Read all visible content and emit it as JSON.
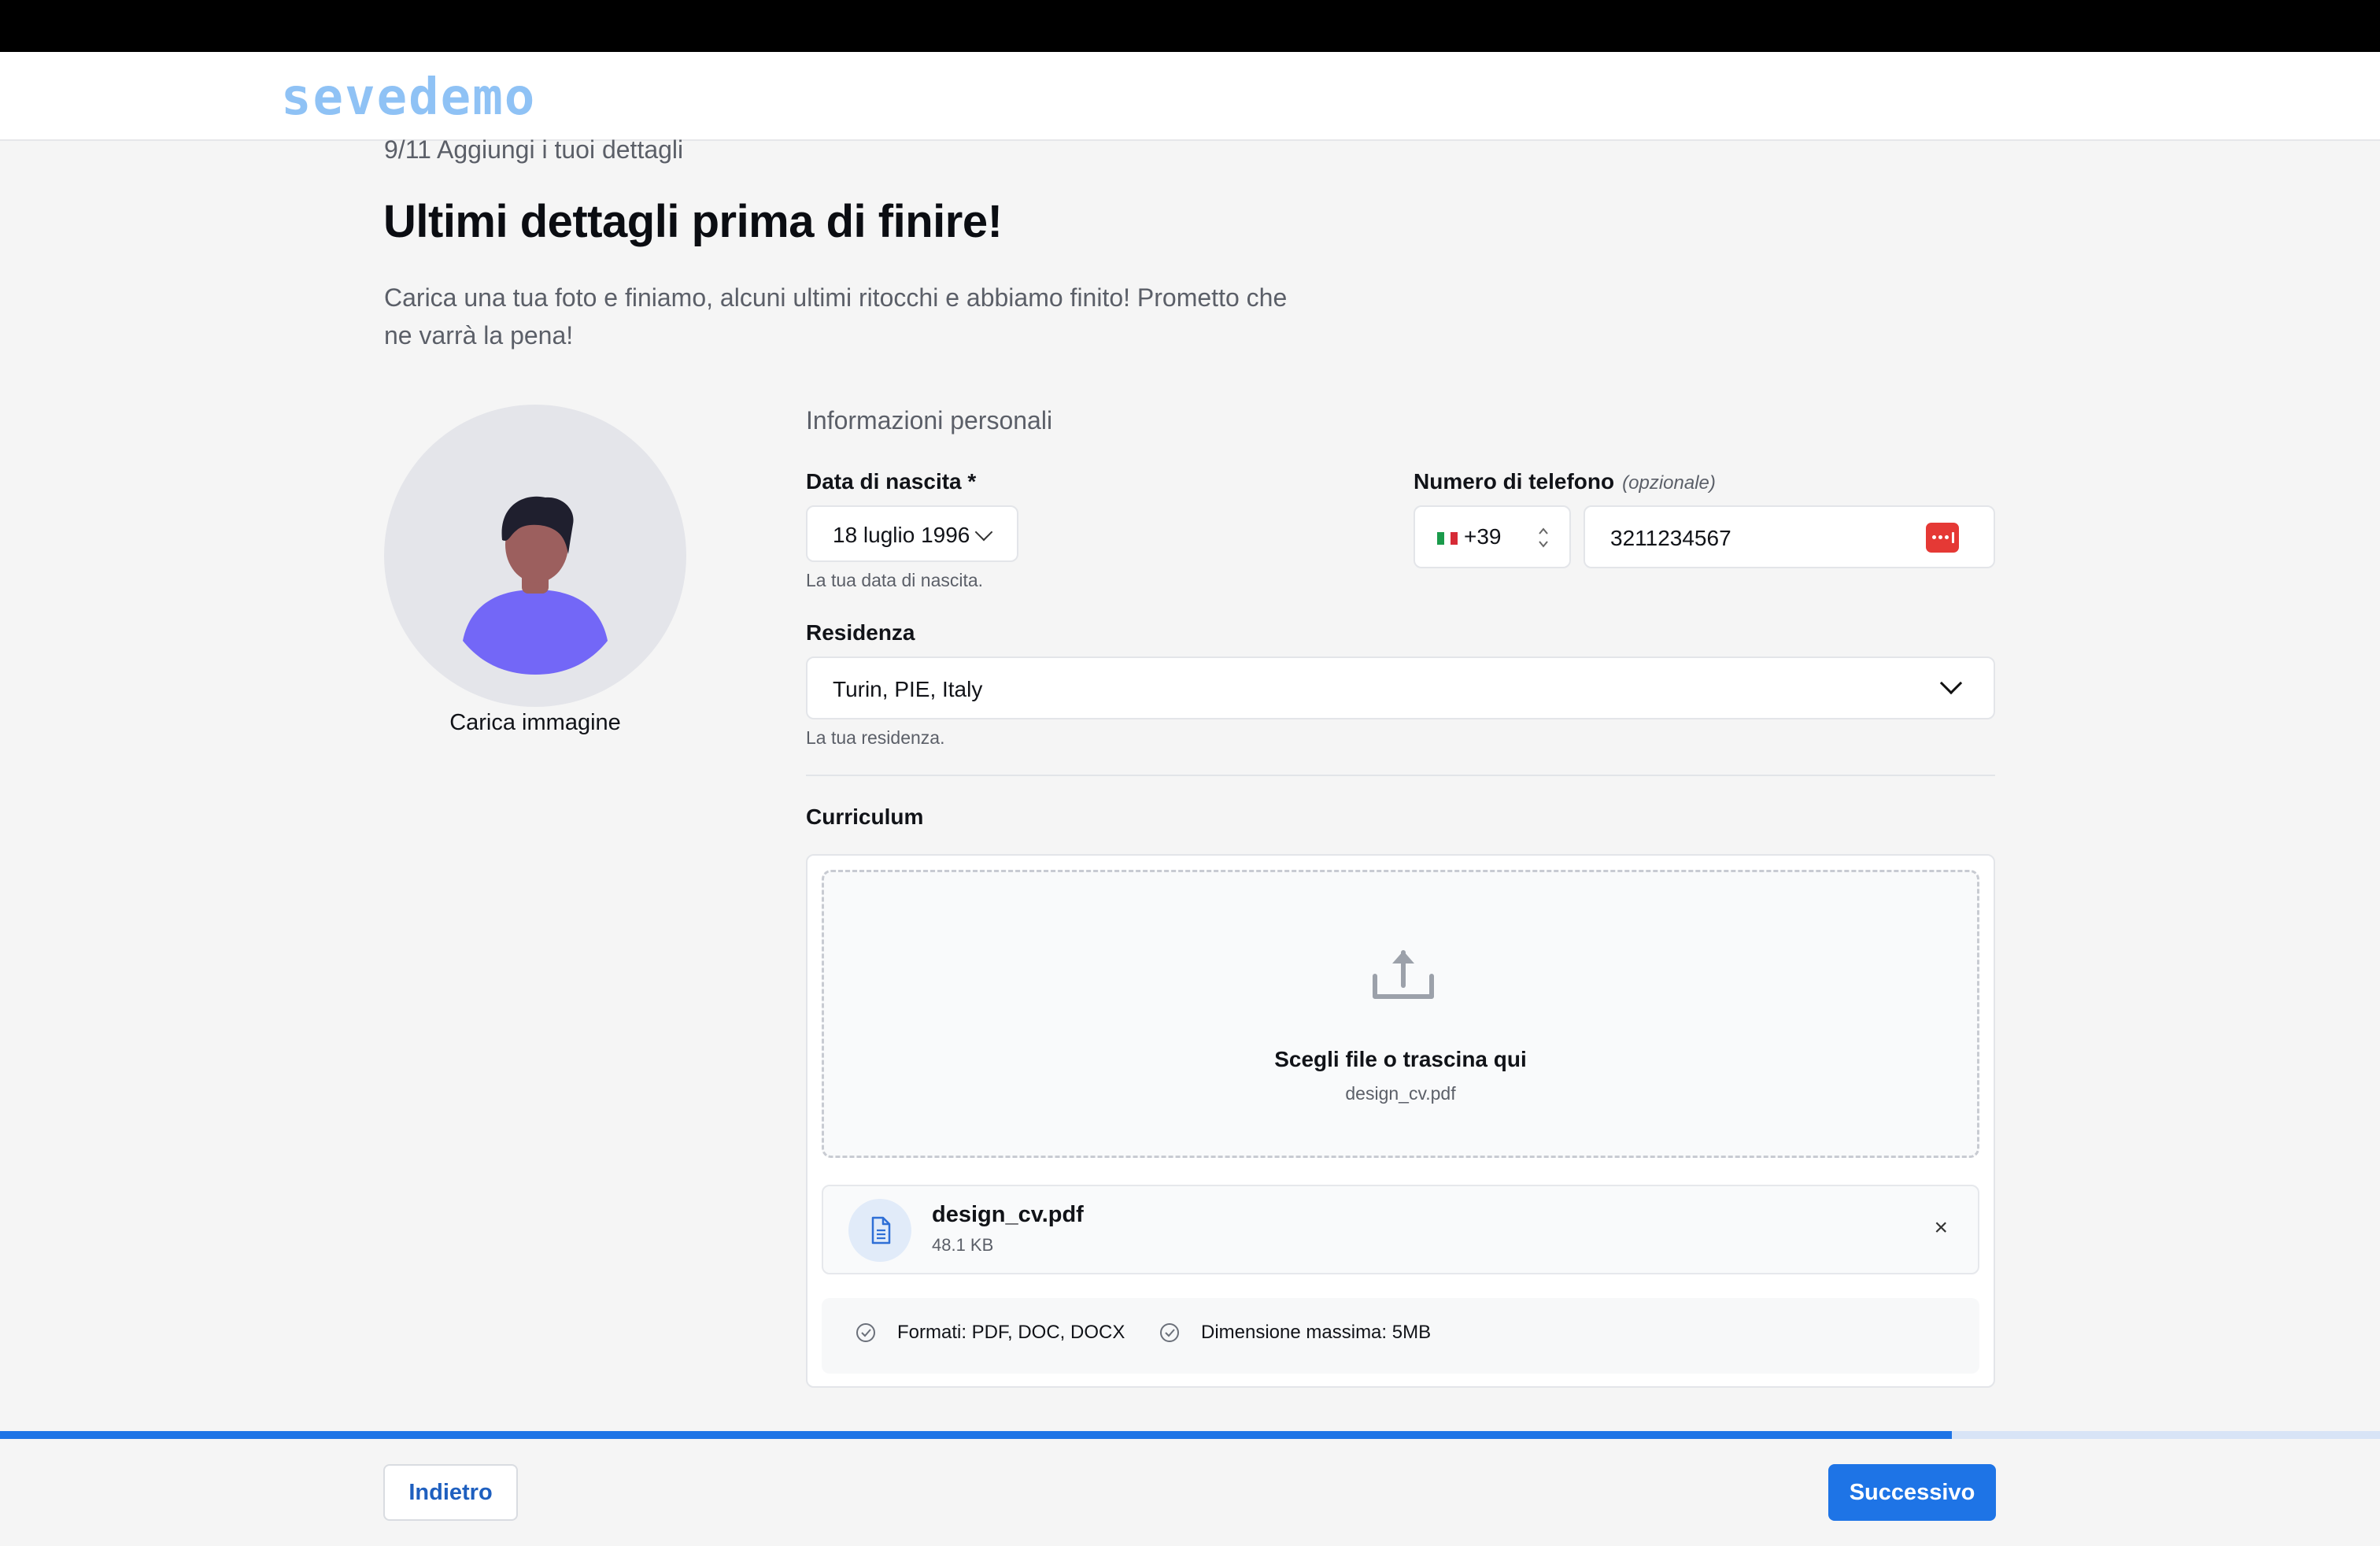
{
  "brand": {
    "logo_text": "sevedemo",
    "logo_color": "#8fc2f5"
  },
  "intro": {
    "step": "9/11 Aggiungi i tuoi dettagli",
    "title": "Ultimi dettagli prima di finire!",
    "subtitle": "Carica una tua foto e finiamo, alcuni ultimi ritocchi e abbiamo finito! Prometto che ne varrà la pena!"
  },
  "avatar": {
    "upload_label": "Carica immagine"
  },
  "personal": {
    "section_title": "Informazioni personali",
    "birth": {
      "label": "Data di nascita *",
      "value": "18 luglio 1996",
      "helper": "La tua data di nascita."
    },
    "phone": {
      "label": "Numero di telefono",
      "optional": "(opzionale)",
      "country_code": "+39",
      "country_flag": "italy-flag-icon",
      "value": "3211234567"
    },
    "residence": {
      "label": "Residenza",
      "value": "Turin, PIE, Italy",
      "helper": "La tua residenza."
    }
  },
  "cv": {
    "label": "Curriculum",
    "dropzone_title": "Scegli file o trascina qui",
    "dropzone_sub": "design_cv.pdf",
    "file": {
      "name": "design_cv.pdf",
      "size": "48.1 KB",
      "remove": "×"
    },
    "requirements": [
      "Formati: PDF, DOC, DOCX",
      "Dimensione massima: 5MB"
    ]
  },
  "progress": {
    "fraction": 0.82
  },
  "footer": {
    "back_label": "Indietro",
    "next_label": "Successivo"
  },
  "colors": {
    "accent": "#1e74e6",
    "error_icon": "#e53935",
    "avatar_bg": "#e4e5ea"
  }
}
